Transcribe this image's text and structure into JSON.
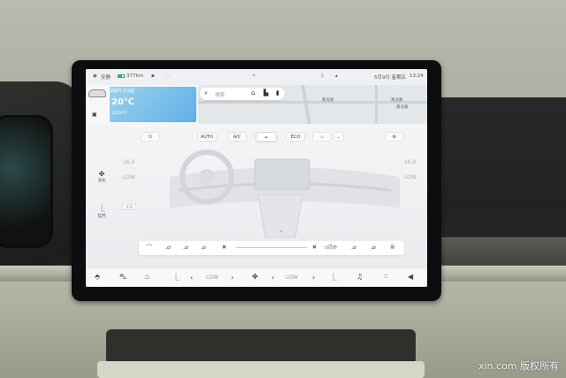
{
  "status": {
    "left_text": "安静",
    "range": "377km",
    "right_text": "5月9日 星期五",
    "time": "13:24"
  },
  "search": {
    "placeholder": "搜索"
  },
  "weather": {
    "location": "成都市 双流区",
    "temperature": "20℃",
    "range": "14/24℃"
  },
  "map": {
    "labels": [
      "黄龙路",
      "黄龙路",
      "黄龙路"
    ]
  },
  "climate": {
    "buttons": [
      "AUTO",
      "A/C",
      "ECO"
    ],
    "left_temp_top": "16.0",
    "left_temp_mid": "LOW",
    "right_temp_top": "16.0",
    "right_temp_mid": "LOW",
    "side_buttons": [
      "净化",
      "挂挡"
    ],
    "tiny_box": "关闭",
    "sync_label": "同步"
  },
  "dock": {
    "left_low": "LOW",
    "right_low": "LOW"
  },
  "watermark": "xin.com 版权所有"
}
